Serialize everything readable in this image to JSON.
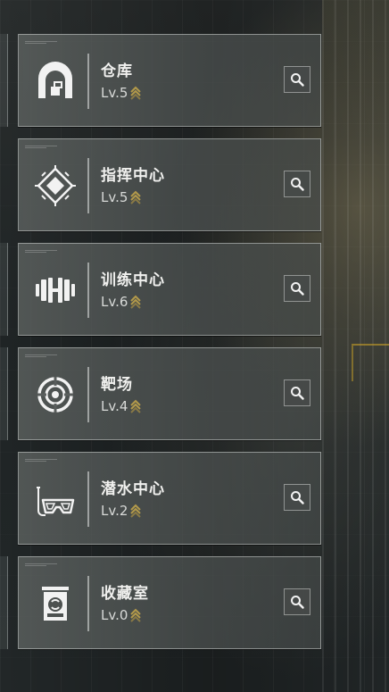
{
  "colors": {
    "card_border": "#cdd2d0",
    "text_primary": "#f0f0ee",
    "text_level": "#d8dad8",
    "upgrade_chevron": "#b39a4a",
    "icon": "#f2f2f2"
  },
  "facilities": [
    {
      "name": "仓库",
      "level": "Lv.5",
      "icon": "warehouse-icon",
      "upgradable": true
    },
    {
      "name": "指挥中心",
      "level": "Lv.5",
      "icon": "command-center-icon",
      "upgradable": true
    },
    {
      "name": "训练中心",
      "level": "Lv.6",
      "icon": "dumbbell-icon",
      "upgradable": true
    },
    {
      "name": "靶场",
      "level": "Lv.4",
      "icon": "target-icon",
      "upgradable": true
    },
    {
      "name": "潜水中心",
      "level": "Lv.2",
      "icon": "diving-mask-icon",
      "upgradable": true
    },
    {
      "name": "收藏室",
      "level": "Lv.0",
      "icon": "collection-room-icon",
      "upgradable": true
    }
  ],
  "search_icon": "magnifier-icon"
}
